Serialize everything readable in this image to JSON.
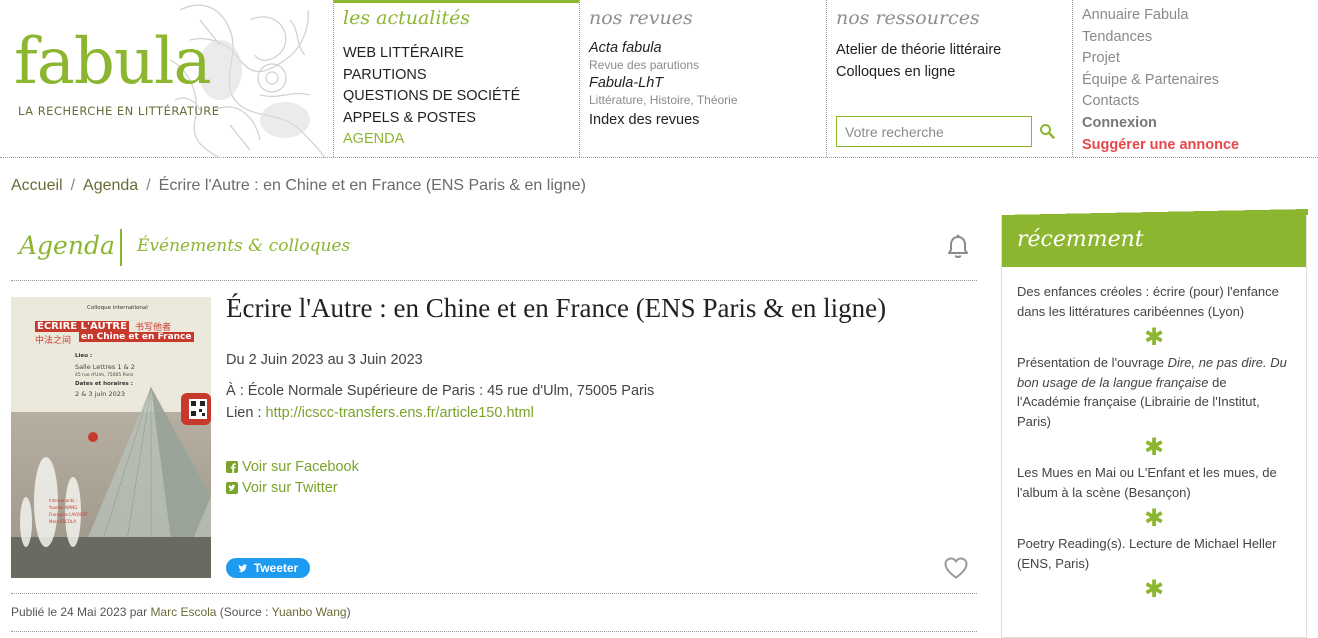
{
  "logo": {
    "word": "fabula",
    "tagline": "LA RECHERCHE EN LITTÉRATURE"
  },
  "nav": {
    "actualites": {
      "heading": "les actualités",
      "items": [
        "WEB LITTÉRAIRE",
        "PARUTIONS",
        "QUESTIONS DE SOCIÉTÉ",
        "APPELS & POSTES",
        "AGENDA"
      ],
      "active": "AGENDA"
    },
    "revues": {
      "heading": "nos revues",
      "items": [
        {
          "title": "Acta fabula",
          "sub": "Revue des parutions"
        },
        {
          "title": "Fabula-LhT",
          "sub": "Littérature, Histoire, Théorie"
        }
      ],
      "index": "Index des revues"
    },
    "ressources": {
      "heading": "nos ressources",
      "items": [
        "Atelier de théorie littéraire",
        "Colloques en ligne"
      ],
      "search_placeholder": "Votre recherche"
    },
    "util": {
      "items": [
        "Annuaire Fabula",
        "Tendances",
        "Projet",
        "Équipe & Partenaires",
        "Contacts"
      ],
      "login": "Connexion",
      "suggest": "Suggérer une annonce"
    }
  },
  "breadcrumb": {
    "home": "Accueil",
    "section": "Agenda",
    "current": "Écrire l'Autre : en Chine et en France (ENS Paris & en ligne)"
  },
  "agenda": {
    "title": "Agenda",
    "subtitle": "Événements & colloques"
  },
  "event": {
    "title": "Écrire l'Autre : en Chine et en France (ENS Paris & en ligne)",
    "dates": "Du 2 Juin 2023 au 3 Juin 2023",
    "place": "À : École Normale Supérieure de Paris : 45 rue d'Ulm, 75005 Paris",
    "link_label": "Lien : ",
    "link_url": "http://icscc-transfers.ens.fr/article150.html",
    "share_facebook": "Voir sur Facebook",
    "share_twitter": "Voir sur Twitter",
    "tweet_button": "Tweeter",
    "poster": {
      "kicker": "Colloque international",
      "title_fr_1": "ÉCRIRE L'AUTRE",
      "title_zh_1": "书写他者",
      "title_zh_2": "中法之间",
      "title_fr_2": "en Chine et en France",
      "lieu_label": "Lieu :",
      "lieu_1": "Salle Lettres 1 & 2",
      "lieu_2": "45 rue d'Ulm, 75005 Paris",
      "dates_label": "Dates et horaires :",
      "dates_value": "2 & 3 juin 2023"
    }
  },
  "published": {
    "prefix": "Publié le 24 Mai 2023 par ",
    "author": "Marc Escola",
    "source_prefix": " (Source : ",
    "source": "Yuanbo Wang",
    "suffix": ")"
  },
  "sidebar": {
    "title": "récemment",
    "items": [
      "Des enfances créoles : écrire (pour) l'enfance dans les littératures caribéennes (Lyon)",
      "Les Mues en Mai ou L'Enfant et les mues, de l'album à la scène (Besançon)",
      "Poetry Reading(s). Lecture de Michael Heller (ENS, Paris)"
    ],
    "item2_prefix": "Présentation de l'ouvrage ",
    "item2_title": "Dire, ne pas dire. Du bon usage de la langue française",
    "item2_suffix": " de l'Académie française (Librairie de l'Institut, Paris)",
    "separator": "✱"
  },
  "colors": {
    "accent": "#8cb62f",
    "link": "#7aa32a",
    "alert": "#e8474a",
    "tweet": "#1d9bf0"
  }
}
